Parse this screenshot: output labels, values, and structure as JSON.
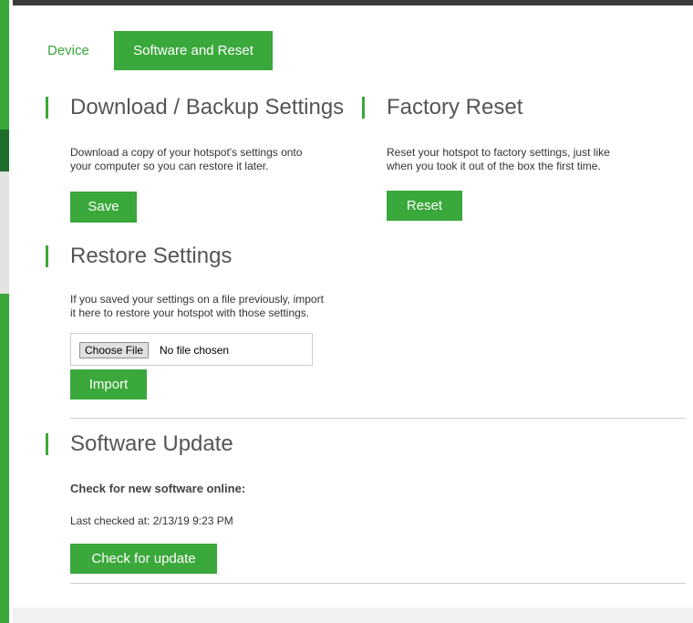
{
  "tabs": [
    {
      "label": "Device",
      "active": false
    },
    {
      "label": "Software and Reset",
      "active": true
    }
  ],
  "backup": {
    "title": "Download / Backup Settings",
    "description_line1": "Download a copy of your hotspot's settings onto",
    "description_line2": "your computer so you can restore it later.",
    "button": "Save"
  },
  "factory_reset": {
    "title": "Factory Reset",
    "description_line1": "Reset your hotspot to factory settings, just like",
    "description_line2": "when you took it out of the box the first time.",
    "button": "Reset"
  },
  "restore": {
    "title": "Restore Settings",
    "description_line1": "If you saved your settings on a file previously, import",
    "description_line2": "it here to restore your hotspot with those settings.",
    "file_button": "Choose File",
    "file_status": "No file chosen",
    "button": "Import"
  },
  "software_update": {
    "title": "Software Update",
    "subheading": "Check for new software online:",
    "last_checked": "Last checked at: 2/13/19 9:23 PM",
    "button": "Check for update"
  },
  "colors": {
    "accent": "#3aa83a",
    "heading_text": "#555555",
    "body_text": "#333333"
  }
}
